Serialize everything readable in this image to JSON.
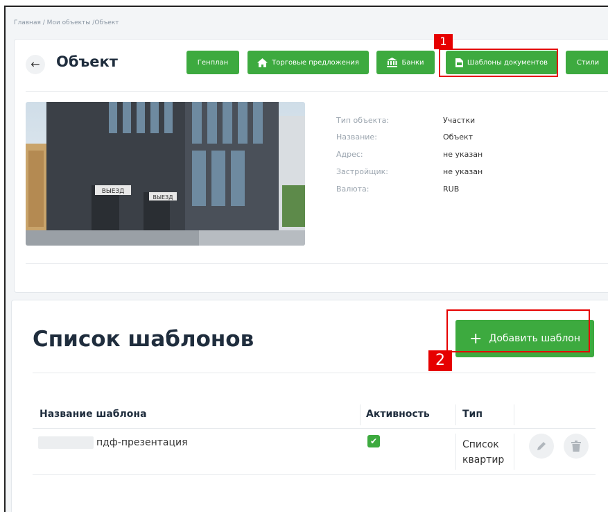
{
  "breadcrumb": {
    "home": "Главная",
    "sep1": "/",
    "objects": "Мои объекты",
    "sep2": "/",
    "current": "Объект"
  },
  "header": {
    "back_icon": "←",
    "title": "Объект",
    "buttons": {
      "genplan": "Генплан",
      "offers": "Торговые предложения",
      "banks": "Банки",
      "templates": "Шаблоны документов",
      "styles": "Стили"
    }
  },
  "details": {
    "type_label": "Тип объекта:",
    "type_value": "Участки",
    "name_label": "Название:",
    "name_value": "Объект",
    "address_label": "Адрес:",
    "address_value": "не указан",
    "developer_label": "Застройщик:",
    "developer_value": "не указан",
    "currency_label": "Валюта:",
    "currency_value": "RUB"
  },
  "photo": {
    "sign1": "ВЫЕЗД",
    "sign2": "ВЫЕЗД"
  },
  "templates_section": {
    "title": "Список шаблонов",
    "add_button": "Добавить шаблон",
    "columns": {
      "name": "Название шаблона",
      "active": "Активность",
      "type": "Тип"
    },
    "rows": [
      {
        "name": "пдф-презентация",
        "type_line1": "Список",
        "type_line2": "квартир"
      }
    ]
  },
  "annotations": {
    "step1": "1",
    "step2": "2"
  },
  "colors": {
    "accent": "#3daa3f",
    "highlight": "#e60000"
  }
}
